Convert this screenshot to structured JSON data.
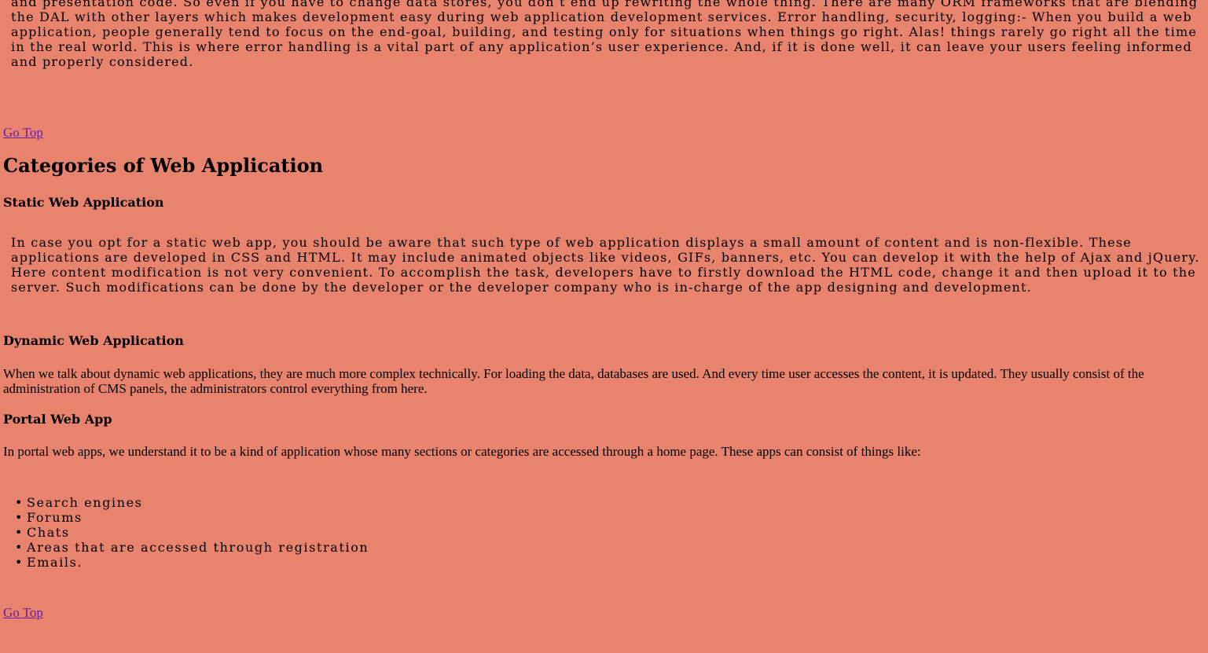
{
  "top_paragraph": "and presentation code. So even if you have to change data stores, you don’t end up rewriting the whole thing. There are many ORM frameworks that are blending the DAL with other layers which makes development easy during web application development services. Error handling, security, logging:- When you build a web application, people generally tend to focus on the end-goal, building, and testing only for situations when things go right. Alas! things rarely go right all the time in the real world. This is where error handling is a vital part of any application’s user experience. And, if it is done well, it can leave your users feeling informed and properly considered.",
  "go_top_label": "Go Top",
  "categories_heading": "Categories of Web Application",
  "static": {
    "heading": "Static Web Application",
    "text": "In case you opt for a static web app, you should be aware that such type of web application displays a small amount of content and is non-flexible. These applications are developed in CSS and HTML. It may include animated objects like videos, GIFs, banners, etc. You can develop it with the help of Ajax and jQuery. Here content modification is not very convenient. To accomplish the task, developers have to firstly download the HTML code, change it and then upload it to the server. Such modifications can be done by the developer or the developer company who is in-charge of the app designing and development."
  },
  "dynamic": {
    "heading": "Dynamic Web Application",
    "text": "When we talk about dynamic web applications, they are much more complex technically. For loading the data, databases are used. And every time user accesses the content, it is updated. They usually consist of the administration of CMS panels, the administrators control everything from here."
  },
  "portal": {
    "heading": "Portal Web App",
    "text": "In portal web apps, we understand it to be a kind of application whose many sections or categories are accessed through a home page. These apps can consist of things like:",
    "items": [
      "Search engines",
      "Forums",
      "Chats",
      "Areas that are accessed through registration",
      "Emails."
    ]
  },
  "colors": {
    "background": "#e8846e",
    "link": "#6b1fa0"
  }
}
